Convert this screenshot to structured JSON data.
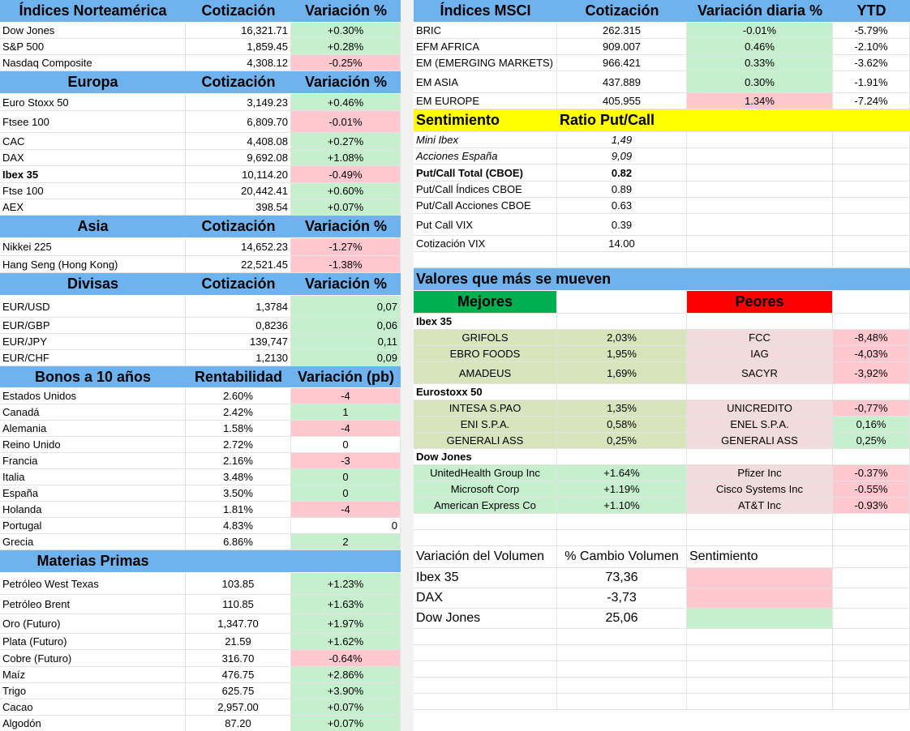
{
  "north": {
    "h1": "Índices Norteamérica",
    "h2": "Cotización",
    "h3": "Variación %",
    "rows": [
      {
        "name": "Dow Jones",
        "value": "16,321.71",
        "change": "+0.30%"
      },
      {
        "name": "S&P 500",
        "value": "1,859.45",
        "change": "+0.28%"
      },
      {
        "name": "Nasdaq Composite",
        "value": "4,308.12",
        "change": "-0.25%"
      }
    ]
  },
  "europe": {
    "h1": "Europa",
    "h2": "Cotización",
    "h3": "Variación %",
    "rows": [
      {
        "name": "Euro Stoxx 50",
        "value": "3,149.23",
        "change": "+0.46%"
      },
      {
        "name": "Ftsee 100",
        "value": "6,809.70",
        "change": "-0.01%"
      },
      {
        "name": "CAC",
        "value": "4,408.08",
        "change": "+0.27%"
      },
      {
        "name": "DAX",
        "value": "9,692.08",
        "change": "+1.08%"
      },
      {
        "name": "Ibex 35",
        "value": "10,114.20",
        "change": "-0.49%"
      },
      {
        "name": "Ftse 100",
        "value": "20,442.41",
        "change": "+0.60%"
      },
      {
        "name": "AEX",
        "value": "398.54",
        "change": "+0.07%"
      }
    ]
  },
  "asia": {
    "h1": "Asia",
    "h2": "Cotización",
    "h3": "Variación %",
    "rows": [
      {
        "name": "Nikkei 225",
        "value": "14,652.23",
        "change": "-1.27%"
      },
      {
        "name": "Hang Seng (Hong Kong)",
        "value": "22,521.45",
        "change": "-1.38%"
      }
    ]
  },
  "fx": {
    "h1": "Divisas",
    "h2": "Cotización",
    "h3": "Variación %",
    "rows": [
      {
        "name": "EUR/USD",
        "value": "1,3784",
        "change": "0,07"
      },
      {
        "name": "EUR/GBP",
        "value": "0,8236",
        "change": "0,06"
      },
      {
        "name": "EUR/JPY",
        "value": "139,747",
        "change": "0,11"
      },
      {
        "name": "EUR/CHF",
        "value": "1,2130",
        "change": "0,09"
      }
    ]
  },
  "bonds": {
    "h1": "Bonos a 10 años",
    "h2": "Rentabilidad",
    "h3": "Variación (pb)",
    "rows": [
      {
        "name": "Estados Unidos",
        "value": "2.60%",
        "change": "-4"
      },
      {
        "name": "Canadá",
        "value": "2.42%",
        "change": "1"
      },
      {
        "name": "Alemania",
        "value": "1.58%",
        "change": "-4"
      },
      {
        "name": "Reino Unido",
        "value": "2.72%",
        "change": "0"
      },
      {
        "name": "Francia",
        "value": "2.16%",
        "change": "-3"
      },
      {
        "name": "Italia",
        "value": "3.48%",
        "change": "0"
      },
      {
        "name": "España",
        "value": "3.50%",
        "change": "0"
      },
      {
        "name": "Holanda",
        "value": "1.81%",
        "change": "-4"
      },
      {
        "name": "Portugal",
        "value": "4.83%",
        "change": "0"
      },
      {
        "name": "Grecia",
        "value": "6.86%",
        "change": "2"
      }
    ]
  },
  "commodities": {
    "h1": "Materias Primas",
    "rows": [
      {
        "name": "Petróleo West Texas",
        "value": "103.85",
        "change": "+1.23%"
      },
      {
        "name": "Petróleo Brent",
        "value": "110.85",
        "change": "+1.63%"
      },
      {
        "name": "Oro (Futuro)",
        "value": "1,347.70",
        "change": "+1.97%"
      },
      {
        "name": "Plata (Futuro)",
        "value": "21.59",
        "change": "+1.62%"
      },
      {
        "name": "Cobre (Futuro)",
        "value": "316.70",
        "change": "-0.64%"
      },
      {
        "name": "Maíz",
        "value": "476.75",
        "change": "+2.86%"
      },
      {
        "name": "Trigo",
        "value": "625.75",
        "change": "+3.90%"
      },
      {
        "name": "Cacao",
        "value": "2,957.00",
        "change": "+0.07%"
      },
      {
        "name": "Algodón",
        "value": "87.20",
        "change": "+0.07%"
      }
    ]
  },
  "msci": {
    "h1": "Índices MSCI",
    "h2": "Cotización",
    "h3": "Variación diaria %",
    "h4": "YTD",
    "rows": [
      {
        "name": "BRIC",
        "value": "262.315",
        "change": "-0.01%",
        "ytd": "-5.79%"
      },
      {
        "name": "EFM AFRICA",
        "value": "909.007",
        "change": "0.46%",
        "ytd": "-2.10%"
      },
      {
        "name": "EM (EMERGING MARKETS)",
        "value": "966.421",
        "change": "0.33%",
        "ytd": "-3.62%"
      },
      {
        "name": "EM ASIA",
        "value": "437.889",
        "change": "0.30%",
        "ytd": "-1.91%"
      },
      {
        "name": "EM EUROPE",
        "value": "405.955",
        "change": "1.34%",
        "ytd": "-7.24%"
      }
    ]
  },
  "sentiment": {
    "h1": "Sentimiento",
    "h2": "Ratio Put/Call",
    "rows": [
      {
        "name": "Mini Ibex",
        "value": "1,49"
      },
      {
        "name": "Acciones España",
        "value": "9,09"
      },
      {
        "name": "Put/Call Total (CBOE)",
        "value": "0.82"
      },
      {
        "name": "Put/Call Índices CBOE",
        "value": "0.89"
      },
      {
        "name": "Put/Call Acciones CBOE",
        "value": "0.63"
      },
      {
        "name": "Put Call VIX",
        "value": "0.39"
      },
      {
        "name": "Cotización VIX",
        "value": "14.00"
      }
    ]
  },
  "movers": {
    "title": "Valores que más se mueven",
    "best": "Mejores",
    "worst": "Peores",
    "groups": [
      {
        "label": "Ibex 35",
        "rows": [
          {
            "best": "GRIFOLS",
            "best_chg": "2,03%",
            "worst": "FCC",
            "worst_chg": "-8,48%"
          },
          {
            "best": "EBRO FOODS",
            "best_chg": "1,95%",
            "worst": "IAG",
            "worst_chg": "-4,03%"
          },
          {
            "best": "AMADEUS",
            "best_chg": "1,69%",
            "worst": "SACYR",
            "worst_chg": "-3,92%"
          }
        ]
      },
      {
        "label": "Eurostoxx 50",
        "rows": [
          {
            "best": "INTESA S.PAO",
            "best_chg": "1,35%",
            "worst": "UNICREDITO",
            "worst_chg": "-0,77%"
          },
          {
            "best": "ENI S.P.A.",
            "best_chg": "0,58%",
            "worst": "ENEL S.P.A.",
            "worst_chg": "0,16%"
          },
          {
            "best": "GENERALI ASS",
            "best_chg": "0,25%",
            "worst": "GENERALI ASS",
            "worst_chg": "0,25%"
          }
        ]
      },
      {
        "label": "Dow Jones",
        "rows": [
          {
            "best": "UnitedHealth Group Inc",
            "best_chg": "+1.64%",
            "worst": "Pfizer Inc",
            "worst_chg": "-0.37%"
          },
          {
            "best": "Microsoft Corp",
            "best_chg": "+1.19%",
            "worst": "Cisco Systems Inc",
            "worst_chg": "-0.55%"
          },
          {
            "best": "American Express Co",
            "best_chg": "+1.10%",
            "worst": "AT&T Inc",
            "worst_chg": "-0.93%"
          }
        ]
      }
    ]
  },
  "volume": {
    "h1": "Variación del Volumen",
    "h2": "% Cambio Volumen",
    "h3": "Sentimiento",
    "rows": [
      {
        "name": "Ibex 35",
        "value": "73,36"
      },
      {
        "name": "DAX",
        "value": "-3,73"
      },
      {
        "name": "Dow Jones",
        "value": "25,06"
      }
    ]
  },
  "colors": {
    "header_blue": "#6fb3ee",
    "positive_green": "#c6efce",
    "negative_pink": "#ffc7ce",
    "sentiment_yellow": "#ffff00",
    "best_green": "#00b050",
    "worst_red": "#ff0000"
  }
}
